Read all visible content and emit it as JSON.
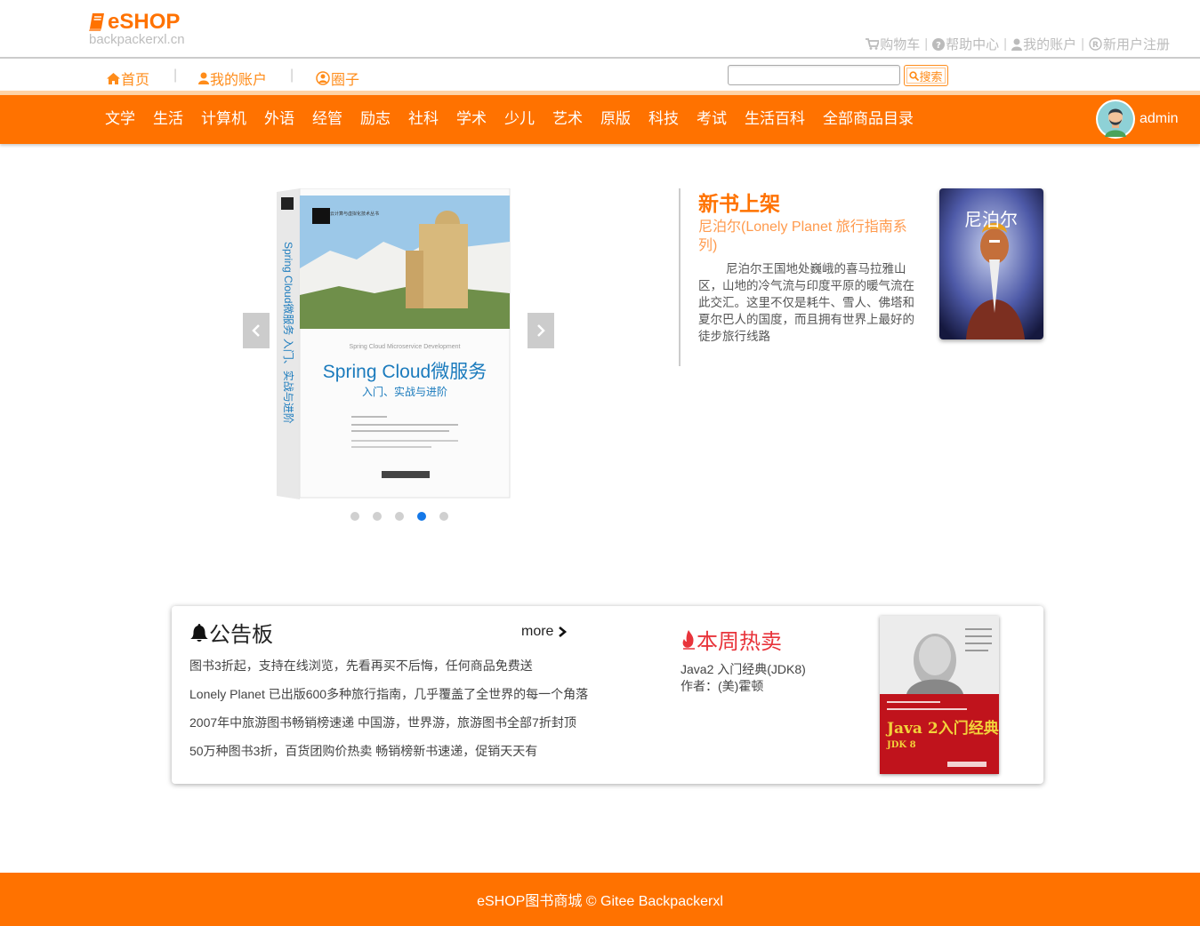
{
  "brand": {
    "logo_text": "eSHOP",
    "domain": "backpackerxl.cn",
    "accent": "#ff7200"
  },
  "toplinks": [
    {
      "label": "购物车",
      "icon": "cart-icon"
    },
    {
      "label": "帮助中心",
      "icon": "help-icon"
    },
    {
      "label": "我的账户",
      "icon": "user-icon"
    },
    {
      "label": "新用户注册",
      "icon": "registered-icon"
    }
  ],
  "nav": {
    "home": "首页",
    "account": "我的账户",
    "circle": "圈子",
    "separator": "|"
  },
  "search": {
    "placeholder": "",
    "button_label": "搜索"
  },
  "categories": [
    "文学",
    "生活",
    "计算机",
    "外语",
    "经管",
    "励志",
    "社科",
    "学术",
    "少儿",
    "艺术",
    "原版",
    "科技",
    "考试",
    "生活百科",
    "全部商品目录"
  ],
  "user": {
    "name": "admin"
  },
  "carousel": {
    "book_series": "云计算与虚拟化技术丛书",
    "book_en_title": "Spring Cloud Microservice Development",
    "book_title": "Spring Cloud微服务",
    "book_subtitle": "入门、实战与进阶",
    "book_spine": "Spring Cloud微服务 入门、实战与进阶",
    "dots_count": 5,
    "active_index": 3
  },
  "new_books": {
    "title": "新书上架",
    "subtitle": "尼泊尔(Lonely Planet 旅行指南系列)",
    "description": "尼泊尔王国地处巍峨的喜马拉雅山区，山地的冷气流与印度平原的暖气流在此交汇。这里不仅是耗牛、雪人、佛塔和夏尔巴人的国度，而且拥有世界上最好的徒步旅行线路",
    "cover_text": "尼泊尔"
  },
  "notice": {
    "title": "公告板",
    "more_label": "more",
    "items": [
      "图书3折起，支持在线浏览，先看再买不后悔，任何商品免费送",
      "Lonely Planet 已出版600多种旅行指南，几乎覆盖了全世界的每一个角落",
      "2007年中旅游图书畅销榜速递 中国游，世界游，旅游图书全部7折封顶",
      "50万种图书3折，百货团购价热卖 畅销榜新书速递，促销天天有"
    ]
  },
  "hot": {
    "title": "本周热卖",
    "book_name": "Java2 入门经典(JDK8)",
    "author": "作者：(美)霍顿",
    "cover_text": "Java 2入门经典",
    "cover_sub": "JDK 8"
  },
  "footer": {
    "text": "eSHOP图书商城 © Gitee Backpackerxl"
  }
}
